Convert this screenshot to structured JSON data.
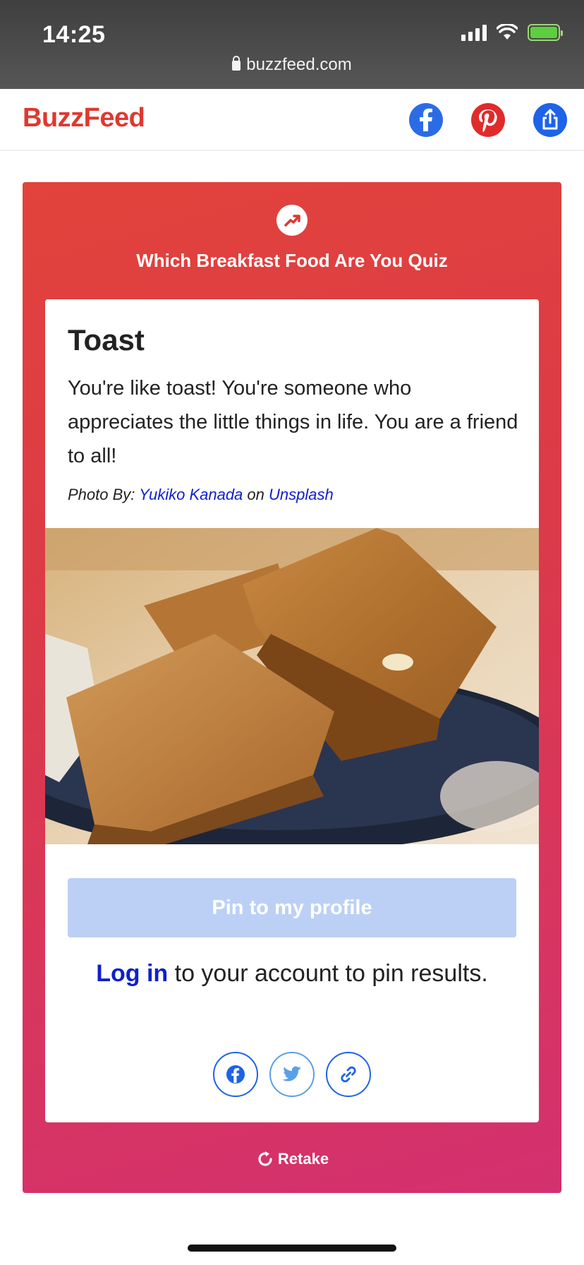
{
  "status_bar": {
    "time": "14:25",
    "url": "buzzfeed.com"
  },
  "header": {
    "logo": "BuzzFeed"
  },
  "quiz": {
    "title": "Which Breakfast Food Are You Quiz",
    "result_title": "Toast",
    "result_description": "You're like toast! You're someone who appreciates the little things in life. You are a friend to all!",
    "credit_prefix": "Photo By:",
    "credit_author": "Yukiko Kanada",
    "credit_on": "on",
    "credit_site": "Unsplash",
    "pin_button": "Pin to my profile",
    "login_link": "Log in",
    "login_rest": " to your account to pin results.",
    "retake": "Retake"
  },
  "colors": {
    "brand": "#e0382f",
    "link": "#0f1fcc",
    "pin_button_bg": "#bcd0f5",
    "card_gradient_top": "#e2433b",
    "card_gradient_bottom": "#d3306f"
  },
  "icons": [
    "lock-icon",
    "signal-icon",
    "wifi-icon",
    "battery-icon",
    "facebook-icon",
    "pinterest-icon",
    "share-icon",
    "trending-icon",
    "twitter-icon",
    "link-icon",
    "retake-icon"
  ]
}
